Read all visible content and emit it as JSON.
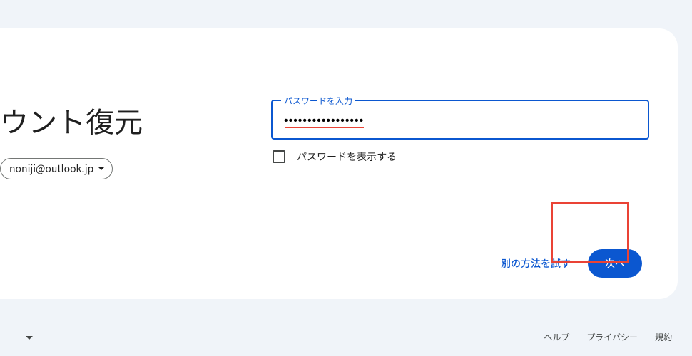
{
  "header": {
    "title": "ウント復元"
  },
  "account": {
    "email": "noniji@outlook.jp"
  },
  "password": {
    "label": "パスワードを入力",
    "value": "•••••••••••••••••",
    "show_label": "パスワードを表示する"
  },
  "actions": {
    "try_other": "別の方法を試す",
    "next": "次へ"
  },
  "footer": {
    "help": "ヘルプ",
    "privacy": "プライバシー",
    "terms": "規約"
  },
  "colors": {
    "primary": "#0b57d0",
    "error": "#ea4335"
  }
}
